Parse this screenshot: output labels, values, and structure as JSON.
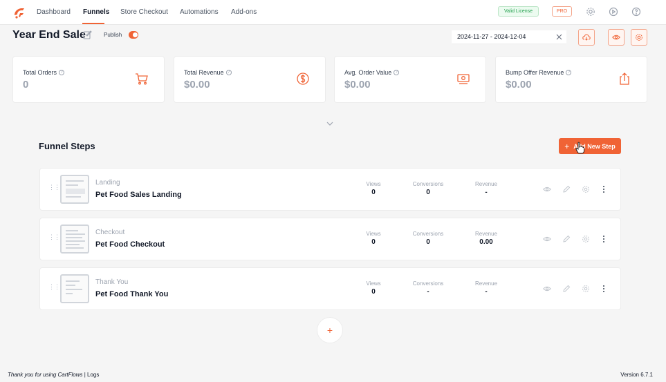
{
  "nav": {
    "items": [
      {
        "label": "Dashboard"
      },
      {
        "label": "Funnels"
      },
      {
        "label": "Store Checkout"
      },
      {
        "label": "Automations"
      },
      {
        "label": "Add-ons"
      }
    ],
    "active": "Funnels",
    "license_badge": "Valid License",
    "pro_badge": "PRO"
  },
  "header": {
    "title": "Year End Sale",
    "publish_label": "Publish",
    "publish_on": true,
    "date_range": "2024-11-27 - 2024-12-04"
  },
  "stats": [
    {
      "label": "Total Orders",
      "value": "0",
      "icon": "cart-icon"
    },
    {
      "label": "Total Revenue",
      "value": "$0.00",
      "icon": "dollar-icon"
    },
    {
      "label": "Avg. Order Value",
      "value": "$0.00",
      "icon": "cash-icon"
    },
    {
      "label": "Bump Offer Revenue",
      "value": "$0.00",
      "icon": "share-icon"
    }
  ],
  "steps_section": {
    "title": "Funnel Steps",
    "add_button": "Add New Step"
  },
  "steps": [
    {
      "type": "Landing",
      "name": "Pet Food Sales Landing",
      "views_label": "Views",
      "views": "0",
      "conv_label": "Conversions",
      "conversions": "0",
      "rev_label": "Revenue",
      "revenue": "-"
    },
    {
      "type": "Checkout",
      "name": "Pet Food Checkout",
      "views_label": "Views",
      "views": "0",
      "conv_label": "Conversions",
      "conversions": "0",
      "rev_label": "Revenue",
      "revenue": "0.00"
    },
    {
      "type": "Thank You",
      "name": "Pet Food Thank You",
      "views_label": "Views",
      "views": "0",
      "conv_label": "Conversions",
      "conversions": "-",
      "rev_label": "Revenue",
      "revenue": "-"
    }
  ],
  "add_circle": "+",
  "footer": {
    "thanks": "Thank you for using CartFlows",
    "separator": " | ",
    "logs": "Logs",
    "version": "Version 6.7.1"
  },
  "colors": {
    "accent": "#f06335",
    "valid": "#1e9e4a"
  }
}
